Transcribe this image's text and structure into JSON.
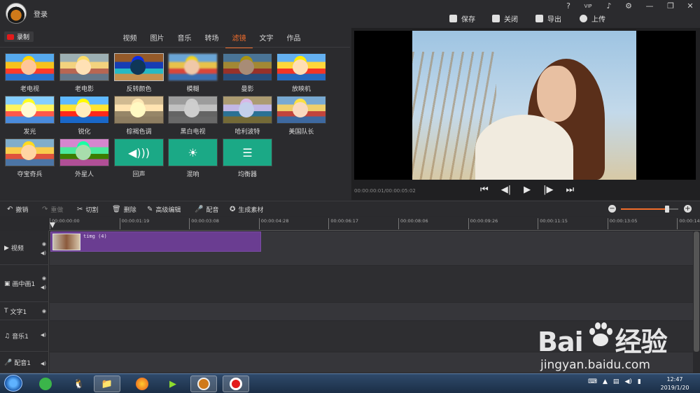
{
  "header": {
    "login_label": "登录",
    "help": "?",
    "vip": "VIP",
    "save": "保存",
    "close": "关闭",
    "export": "导出",
    "upload": "上传"
  },
  "library": {
    "record_label": "录制",
    "tabs": [
      {
        "label": "视频"
      },
      {
        "label": "图片"
      },
      {
        "label": "音乐"
      },
      {
        "label": "转场"
      },
      {
        "label": "滤镜",
        "active": true
      },
      {
        "label": "文字"
      },
      {
        "label": "作品"
      }
    ],
    "effects": [
      {
        "label": "老电视"
      },
      {
        "label": "老电影"
      },
      {
        "label": "反转颜色"
      },
      {
        "label": "模糊"
      },
      {
        "label": "曼影"
      },
      {
        "label": "放映机"
      },
      {
        "label": "发光"
      },
      {
        "label": "锐化"
      },
      {
        "label": "棕褐色调"
      },
      {
        "label": "黑白电视"
      },
      {
        "label": "哈利波特"
      },
      {
        "label": "美国队长"
      },
      {
        "label": "夺宝奇兵"
      },
      {
        "label": "外星人"
      },
      {
        "label": "回声"
      },
      {
        "label": "混响"
      },
      {
        "label": "均衡器"
      }
    ]
  },
  "preview": {
    "timecode": "00:00:00:01/00:00:05:02"
  },
  "toolbar": {
    "undo": "撤销",
    "redo": "重做",
    "cut": "切割",
    "delete": "删除",
    "advanced_edit": "高级编辑",
    "dub": "配音",
    "generate": "生成素材",
    "zoom_level": 0.8
  },
  "timeline": {
    "ruler": [
      "00:00:00:00",
      "00:00:01:19",
      "00:00:03:08",
      "00:00:04:28",
      "00:00:06:17",
      "00:00:08:06",
      "00:00:09:26",
      "00:00:11:15",
      "00:00:13:05",
      "00:00:14:"
    ],
    "tracks": [
      {
        "label": "视频"
      },
      {
        "label": "画中画1"
      },
      {
        "label": "文字1"
      },
      {
        "label": "音乐1"
      },
      {
        "label": "配音1"
      }
    ],
    "clip_name": "timg (4)"
  },
  "taskbar": {
    "time": "12:47",
    "date": "2019/1/20"
  },
  "watermark": {
    "brand": "Bai",
    "brand2": "经验",
    "url": "jingyan.baidu.com"
  },
  "colors": {
    "accent": "#f26d2b",
    "clip": "#6a3d91",
    "teal": "#1ba986",
    "record": "#e31b1b"
  }
}
